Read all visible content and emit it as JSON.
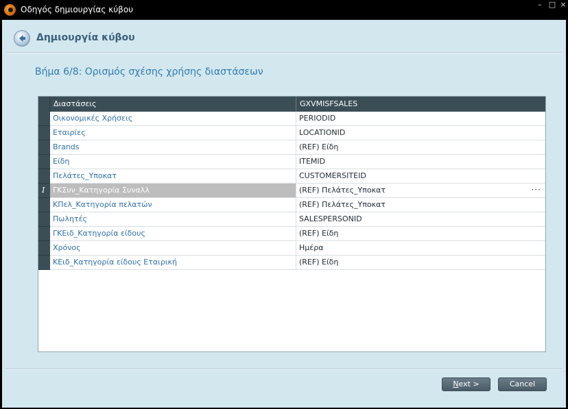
{
  "window": {
    "title": "Οδηγός δημιουργίας κύβου",
    "controls": {
      "minimize": "–",
      "maximize": "□",
      "close": "×"
    }
  },
  "header": {
    "title": "Δημιουργία κύβου",
    "back_icon": "back-arrow-icon"
  },
  "step": {
    "title": "Βήμα 6/8: Ορισμός σχέσης χρήσης διαστάσεων"
  },
  "grid": {
    "columns": [
      "Διαστάσεις",
      "GXVMISFSALES"
    ],
    "rows": [
      {
        "dimension": "Οικονομικές Χρήσεις",
        "value": "PERIODID"
      },
      {
        "dimension": "Εταιρίες",
        "value": "LOCATIONID"
      },
      {
        "dimension": "Brands",
        "value": "(REF) Είδη"
      },
      {
        "dimension": "Είδη",
        "value": "ITEMID"
      },
      {
        "dimension": "Πελάτες_Υποκατ",
        "value": "CUSTOMERSITEID"
      },
      {
        "dimension": "ΓΚΣυν_Κατηγορία Συναλλ",
        "value": "(REF) Πελάτες_Υποκατ",
        "selected": true,
        "indicator": "I",
        "ellipsis": "···"
      },
      {
        "dimension": "ΚΠελ_Κατηγορία πελατών",
        "value": "(REF) Πελάτες_Υποκατ"
      },
      {
        "dimension": "Πωλητές",
        "value": "SALESPERSONID"
      },
      {
        "dimension": "ΓΚΕιδ_Κατηγορία είδους",
        "value": "(REF) Είδη"
      },
      {
        "dimension": "Χρόνος",
        "value": "Ημέρα"
      },
      {
        "dimension": "ΚΕιδ_Κατηγορία είδους Εταιρική",
        "value": "(REF) Είδη"
      }
    ]
  },
  "footer": {
    "next_mnemonic": "N",
    "next_rest": "ext >",
    "cancel_label": "Cancel"
  },
  "colors": {
    "background": "#d3e7ee",
    "accent": "#2f7db0",
    "grid_header": "#3b4e56",
    "selection": "#bdbdbd"
  }
}
